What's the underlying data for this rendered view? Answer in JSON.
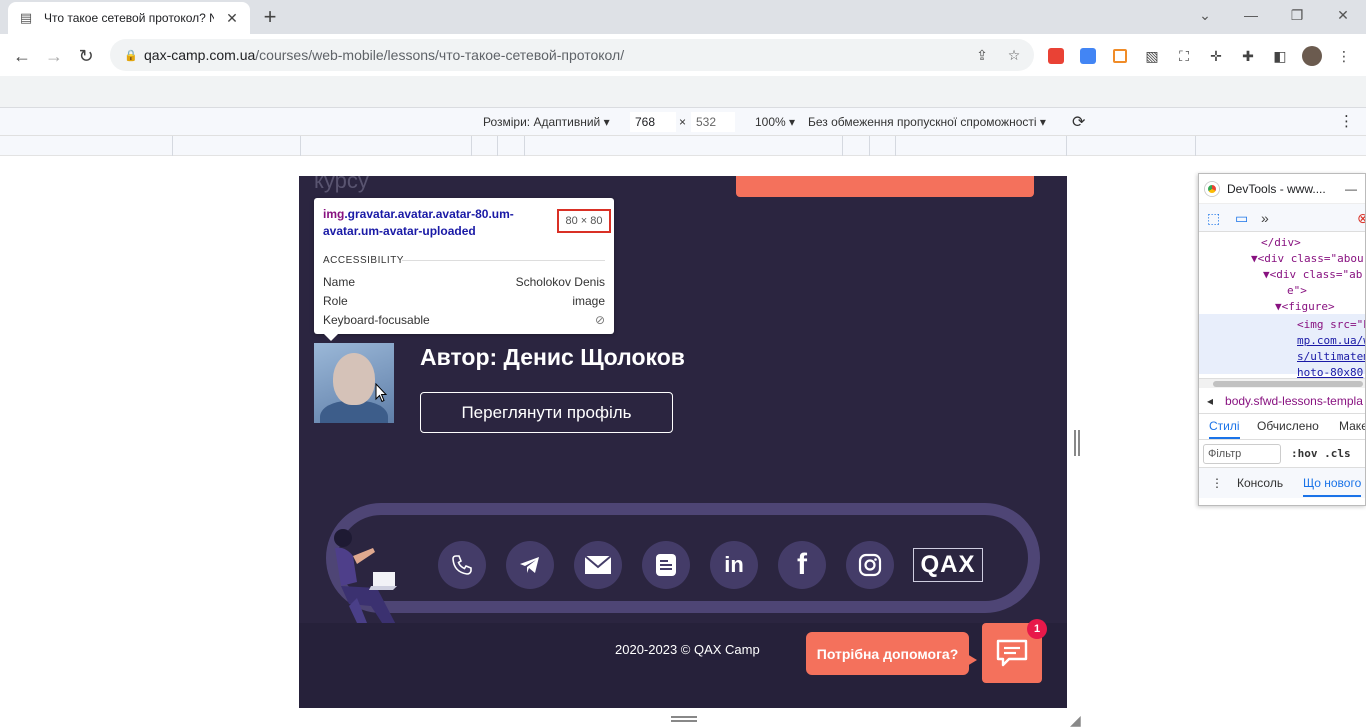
{
  "browser": {
    "tab_title": "Что такое сетевой протокол? N",
    "tab_favicon": "book-icon",
    "new_tab": "+",
    "url_domain": "qax-camp.com.ua",
    "url_path": "/courses/web-mobile/lessons/что-такое-сетевой-протокол/"
  },
  "device_toolbar": {
    "dimensions_label": "Розміри: Адаптивний",
    "width": "768",
    "times": "×",
    "height": "532",
    "zoom": "100%",
    "throttling": "Без обмеження пропускної спроможності"
  },
  "page": {
    "cutoff_text": "курсу",
    "author": "Автор: Денис Щолоков",
    "profile_button": "Переглянути профіль",
    "logo_text": "QAX",
    "copyright": "2020-2023 © QAX Camp",
    "help_text": "Потрібна допомога?",
    "help_badge": "1",
    "social_icons": [
      "phone-icon",
      "telegram-icon",
      "mail-icon",
      "blog-icon",
      "linkedin-icon",
      "facebook-icon",
      "instagram-icon"
    ]
  },
  "inspect_tooltip": {
    "selector_tag": "img",
    "selector_classes": ".gravatar.avatar.avatar-80.um-avatar.um-avatar-uploaded",
    "size": "80 × 80",
    "accessibility_heading": "ACCESSIBILITY",
    "rows": [
      {
        "label": "Name",
        "value": "Scholokov Denis"
      },
      {
        "label": "Role",
        "value": "image"
      },
      {
        "label": "Keyboard-focusable",
        "value": ""
      }
    ]
  },
  "devtools": {
    "title": "DevTools - www....",
    "code_lines": [
      "</div>",
      "▼<div class=\"abou",
      "▼<div class=\"ab",
      "e\">",
      "▼<figure>",
      "<img src=\"h",
      "mp.com.ua/w",
      "s/ultimatem",
      "hoto-80x80"
    ],
    "breadcrumb": "body.sfwd-lessons-templa",
    "tabs": [
      "Стилі",
      "Обчислено",
      "Маке"
    ],
    "filter_placeholder": "Фільтр",
    "hov_cls": ":hov  .cls",
    "drawer_tabs": [
      "Консоль",
      "Що нового"
    ]
  },
  "colors": {
    "page_bg": "#2b2540",
    "accent": "#f4715c",
    "badge": "#e8194a",
    "ring": "#4e4575"
  }
}
